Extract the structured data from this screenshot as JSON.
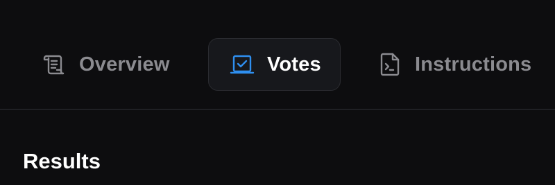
{
  "tabs": [
    {
      "id": "overview",
      "label": "Overview",
      "icon": "scroll-icon",
      "active": false
    },
    {
      "id": "votes",
      "label": "Votes",
      "icon": "ballot-box-icon",
      "active": true
    },
    {
      "id": "instructions",
      "label": "Instructions",
      "icon": "terminal-file-icon",
      "active": false
    }
  ],
  "section": {
    "title": "Results"
  },
  "colors": {
    "background": "#0d0d0f",
    "active_tab_bg": "#17181c",
    "inactive_text": "#8b8b90",
    "accent": "#2f8ff0"
  }
}
